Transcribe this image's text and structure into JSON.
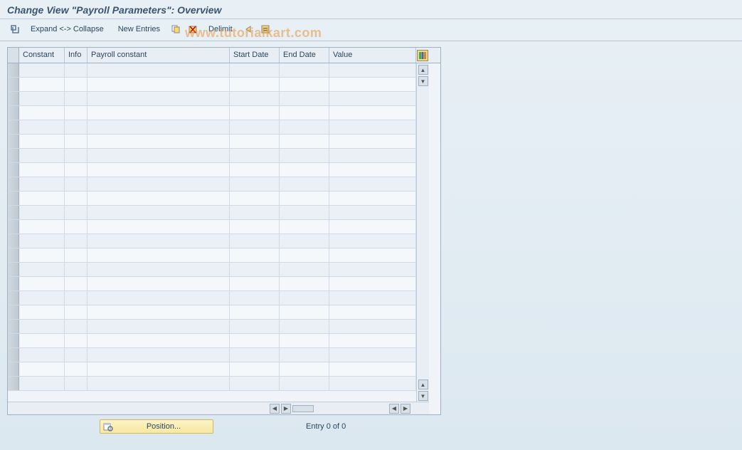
{
  "title": "Change View \"Payroll Parameters\": Overview",
  "toolbar": {
    "expand_collapse": "Expand <-> Collapse",
    "new_entries": "New Entries",
    "delimit": "Delimit"
  },
  "columns": {
    "constant": "Constant",
    "info": "Info",
    "payroll_constant": "Payroll constant",
    "start_date": "Start Date",
    "end_date": "End Date",
    "value": "Value"
  },
  "rows": [
    {},
    {},
    {},
    {},
    {},
    {},
    {},
    {},
    {},
    {},
    {},
    {},
    {},
    {},
    {},
    {},
    {},
    {},
    {},
    {},
    {},
    {},
    {}
  ],
  "footer": {
    "position": "Position...",
    "entry": "Entry 0 of 0"
  },
  "watermark": "www.tutorialkart.com"
}
